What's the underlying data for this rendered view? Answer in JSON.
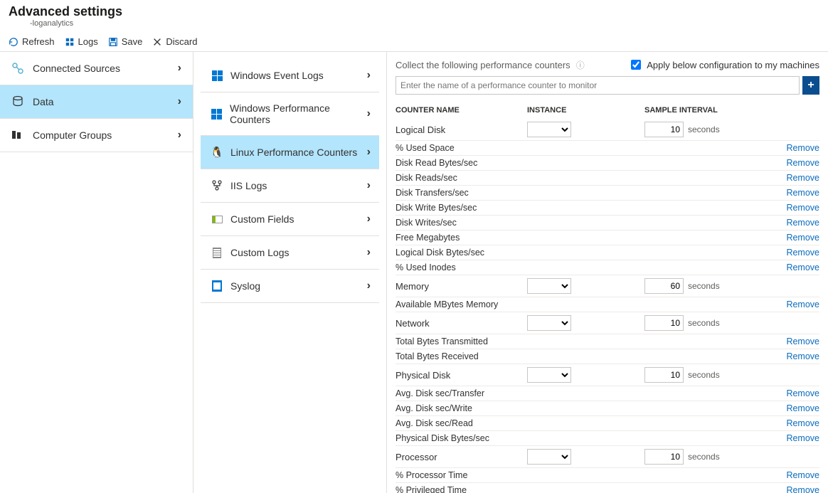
{
  "header": {
    "title": "Advanced settings",
    "subtitle": "-loganalytics"
  },
  "toolbar": {
    "refresh": "Refresh",
    "logs": "Logs",
    "save": "Save",
    "discard": "Discard"
  },
  "nav1": {
    "items": [
      {
        "label": "Connected Sources",
        "icon": "connected-sources-icon"
      },
      {
        "label": "Data",
        "icon": "data-icon",
        "selected": true
      },
      {
        "label": "Computer Groups",
        "icon": "computer-groups-icon"
      }
    ]
  },
  "nav2": {
    "items": [
      {
        "label": "Windows Event Logs",
        "icon": "windows-icon"
      },
      {
        "label": "Windows Performance Counters",
        "icon": "windows-icon"
      },
      {
        "label": "Linux Performance Counters",
        "icon": "linux-icon",
        "selected": true
      },
      {
        "label": "IIS Logs",
        "icon": "iis-icon"
      },
      {
        "label": "Custom Fields",
        "icon": "custom-fields-icon"
      },
      {
        "label": "Custom Logs",
        "icon": "custom-logs-icon"
      },
      {
        "label": "Syslog",
        "icon": "syslog-icon"
      }
    ]
  },
  "main": {
    "collect_label": "Collect the following performance counters",
    "apply_label": "Apply below configuration to my machines",
    "apply_checked": true,
    "search_placeholder": "Enter the name of a performance counter to monitor",
    "add_symbol": "+",
    "columns": {
      "name": "COUNTER NAME",
      "instance": "INSTANCE",
      "sample": "SAMPLE INTERVAL"
    },
    "seconds_label": "seconds",
    "remove_label": "Remove",
    "groups": [
      {
        "name": "Logical Disk",
        "interval": "10",
        "counters": [
          "% Used Space",
          "Disk Read Bytes/sec",
          "Disk Reads/sec",
          "Disk Transfers/sec",
          "Disk Write Bytes/sec",
          "Disk Writes/sec",
          "Free Megabytes",
          "Logical Disk Bytes/sec",
          "% Used Inodes"
        ]
      },
      {
        "name": "Memory",
        "interval": "60",
        "counters": [
          "Available MBytes Memory"
        ]
      },
      {
        "name": "Network",
        "interval": "10",
        "counters": [
          "Total Bytes Transmitted",
          "Total Bytes Received"
        ]
      },
      {
        "name": "Physical Disk",
        "interval": "10",
        "counters": [
          "Avg. Disk sec/Transfer",
          "Avg. Disk sec/Write",
          "Avg. Disk sec/Read",
          "Physical Disk Bytes/sec"
        ]
      },
      {
        "name": "Processor",
        "interval": "10",
        "counters": [
          "% Processor Time",
          "% Privileged Time"
        ]
      }
    ]
  }
}
